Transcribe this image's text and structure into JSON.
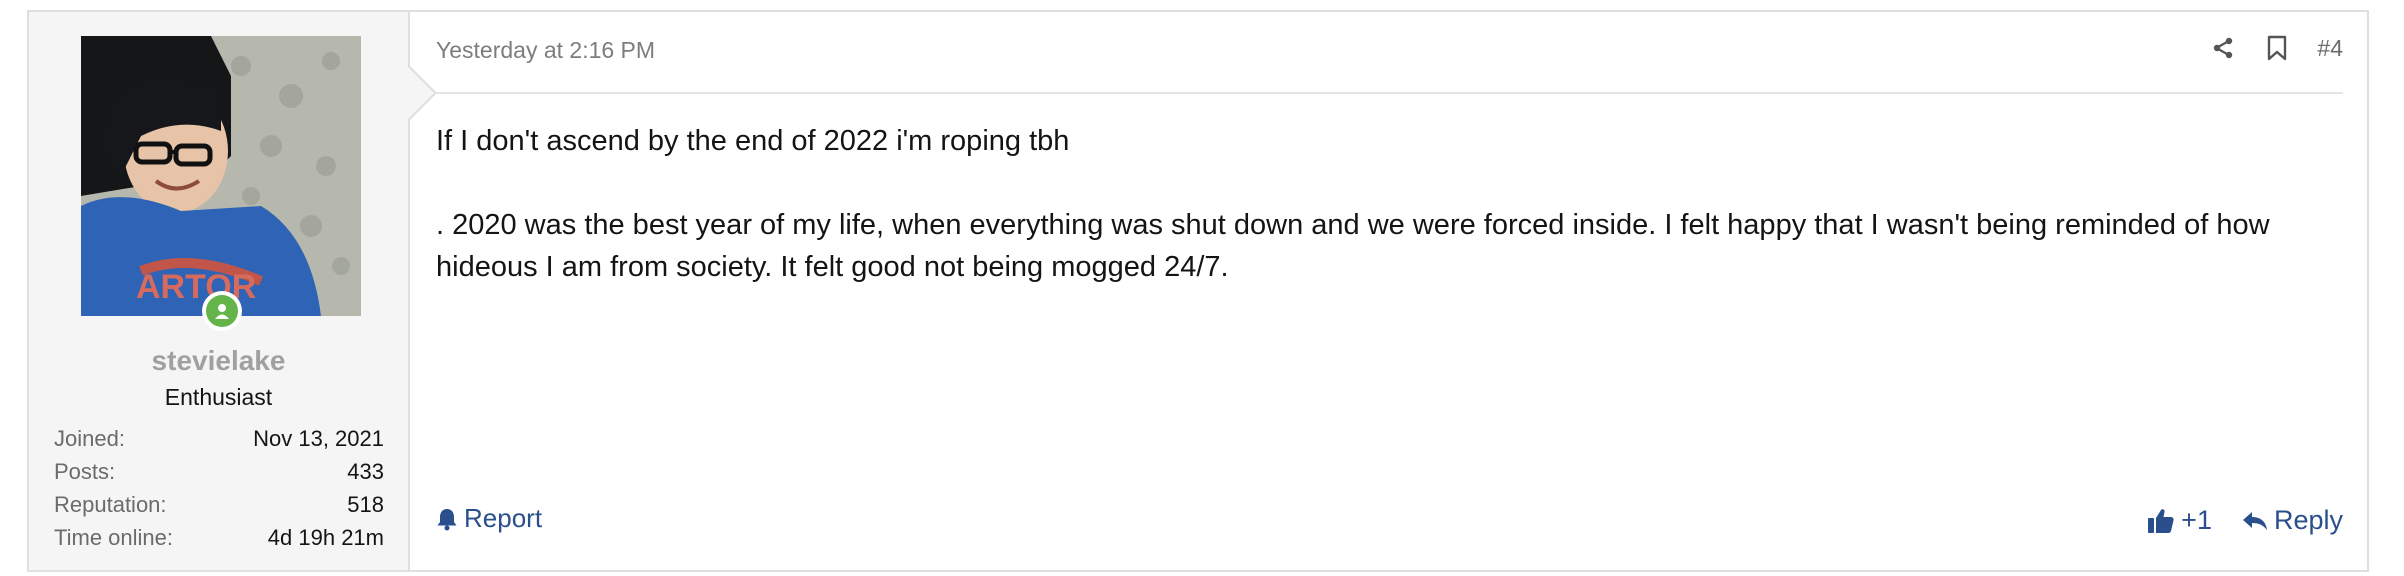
{
  "user": {
    "username": "stevielake",
    "title": "Enthusiast",
    "online": true,
    "avatar_icon": "user-avatar-photo",
    "stats": [
      {
        "label": "Joined:",
        "value": "Nov 13, 2021"
      },
      {
        "label": "Posts:",
        "value": "433"
      },
      {
        "label": "Reputation:",
        "value": "518"
      },
      {
        "label": "Time online:",
        "value": "4d 19h 21m"
      }
    ]
  },
  "post": {
    "timestamp": "Yesterday at 2:16 PM",
    "number": "#4",
    "paragraphs": [
      "If I don't ascend by the end of 2022 i'm roping tbh",
      ". 2020 was the best year of my life, when everything was shut down and we were forced inside. I felt happy that I wasn't being reminded of how hideous I am from society. It felt good not being mogged 24/7."
    ]
  },
  "actions": {
    "report_label": "Report",
    "like_count": "+1",
    "reply_label": "Reply"
  },
  "colors": {
    "link": "#2b4f8c",
    "online": "#63b54a",
    "user_cell_bg": "#f5f5f5",
    "border": "#dfdfdf"
  }
}
